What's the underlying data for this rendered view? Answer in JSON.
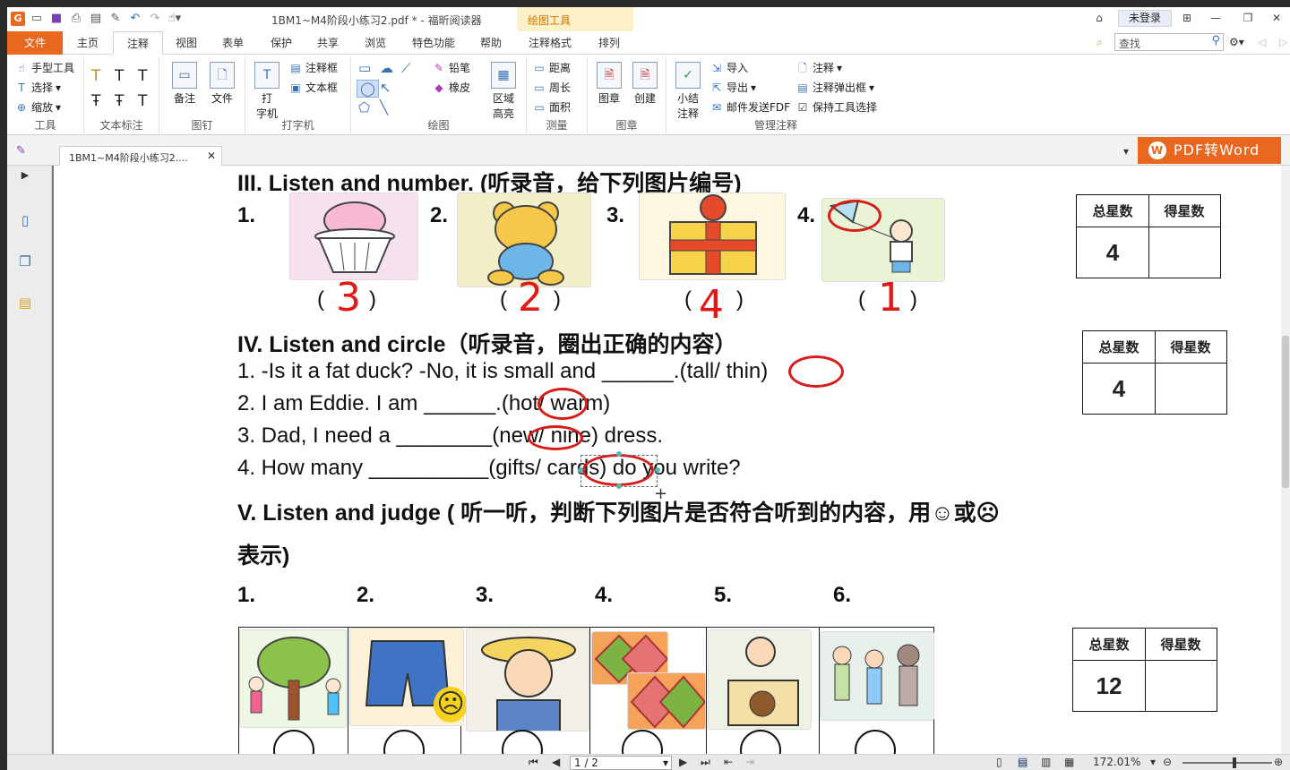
{
  "titlebar": {
    "doc_title": "1BM1~M4阶段小练习2.pdf * - 福昕阅读器",
    "context_tab": "绘图工具",
    "login": "未登录"
  },
  "menu": {
    "file": "文件",
    "tabs": [
      "主页",
      "注释",
      "视图",
      "表单",
      "保护",
      "共享",
      "浏览",
      "特色功能",
      "帮助",
      "注释格式",
      "排列"
    ],
    "search_placeholder": "查找"
  },
  "ribbon": {
    "tools": {
      "label": "工具",
      "hand": "手型工具",
      "select": "选择",
      "zoom": "缩放"
    },
    "text_markup": {
      "label": "文本标注"
    },
    "pin": {
      "label": "图钉",
      "note": "备注",
      "file": "文件"
    },
    "typewriter": {
      "label": "打字机",
      "typewriter": "打\n字机",
      "callout": "注释框",
      "textbox": "文本框"
    },
    "drawing": {
      "label": "绘图",
      "pencil": "铅笔",
      "eraser": "橡皮",
      "area_highlight": "区域\n高亮"
    },
    "measure": {
      "label": "测量",
      "distance": "距离",
      "perimeter": "周长",
      "area": "面积"
    },
    "stamp": {
      "label": "图章",
      "stamp": "图章",
      "create": "创建"
    },
    "manage": {
      "label": "管理注释",
      "summary": "小结\n注释",
      "import": "导入",
      "export": "导出",
      "email": "邮件发送FDF",
      "comment": "注释",
      "popup": "注释弹出框",
      "keep": "保持工具选择"
    }
  },
  "doctab": {
    "name": "1BM1~M4阶段小练习2...."
  },
  "promo": {
    "label": "PDF转Word"
  },
  "page": {
    "sec3": {
      "title": "III. Listen and number. (听录音，给下列图片编号)",
      "items": [
        {
          "n": "1.",
          "answer": "3"
        },
        {
          "n": "2.",
          "answer": "2"
        },
        {
          "n": "3.",
          "answer": "4"
        },
        {
          "n": "4.",
          "answer": "1"
        }
      ],
      "stars": {
        "total_label": "总星数",
        "got_label": "得星数",
        "total": "4",
        "got": ""
      }
    },
    "sec4": {
      "title": "IV. Listen and circle（听录音，圈出正确的内容）",
      "lines": [
        "1. -Is it a fat duck? -No, it is small and  ______.(tall/ thin)",
        "2. I am Eddie. I am  ______.(hot/ warm)",
        "3. Dad, I need a  ________(new/ nine) dress.",
        "4. How many  __________(gifts/ cards) do you write?"
      ],
      "stars": {
        "total_label": "总星数",
        "got_label": "得星数",
        "total": "4",
        "got": ""
      }
    },
    "sec5": {
      "title": "V. Listen and judge (  听一听，判断下列图片是否符合听到的内容，用☺或☹",
      "title2": "表示)",
      "nums": [
        "1.",
        "2.",
        "3.",
        "4.",
        "5.",
        "6."
      ],
      "stars": {
        "total_label": "总星数",
        "got_label": "得星数",
        "total": "12",
        "got": ""
      }
    }
  },
  "status": {
    "page": "1 / 2",
    "zoom": "172.01%"
  }
}
